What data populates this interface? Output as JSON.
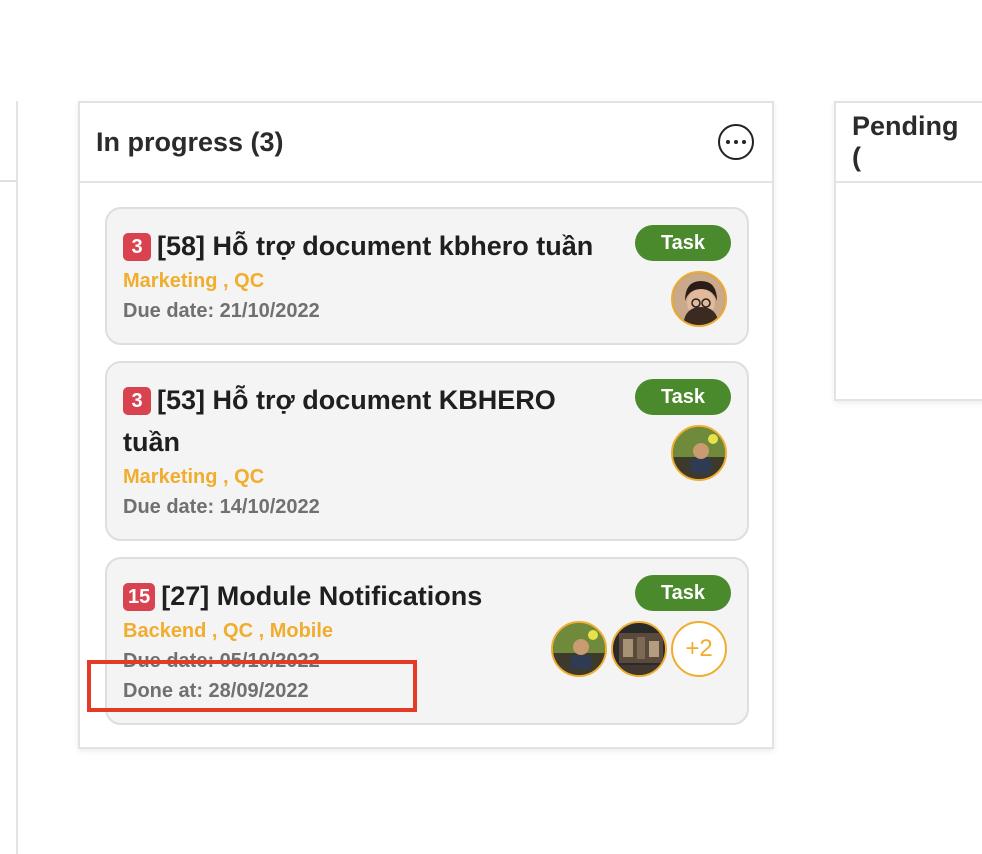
{
  "columns": {
    "in_progress": {
      "title": "In progress (3)",
      "cards": [
        {
          "count": "3",
          "title": "[58] Hỗ trợ document kbhero tuần",
          "tags": "Marketing , QC",
          "due": "Due date: 21/10/2022",
          "type": "Task"
        },
        {
          "count": "3",
          "title": "[53] Hỗ trợ document KBHERO tuần",
          "tags": "Marketing , QC",
          "due": "Due date: 14/10/2022",
          "type": "Task"
        },
        {
          "count": "15",
          "title": "[27] Module Notifications",
          "tags": "Backend , QC , Mobile",
          "due": "Due date: 05/10/2022",
          "done": "Done at: 28/09/2022",
          "type": "Task",
          "extra_assignees": "+2"
        }
      ]
    },
    "pending": {
      "title": "Pending ("
    }
  },
  "colors": {
    "count_badge": "#d9434f",
    "task_badge": "#4a8a2c",
    "tags": "#f0ad2e",
    "highlight": "#e53a26"
  },
  "icons": {
    "column_menu": "more-horizontal-circle-icon"
  }
}
